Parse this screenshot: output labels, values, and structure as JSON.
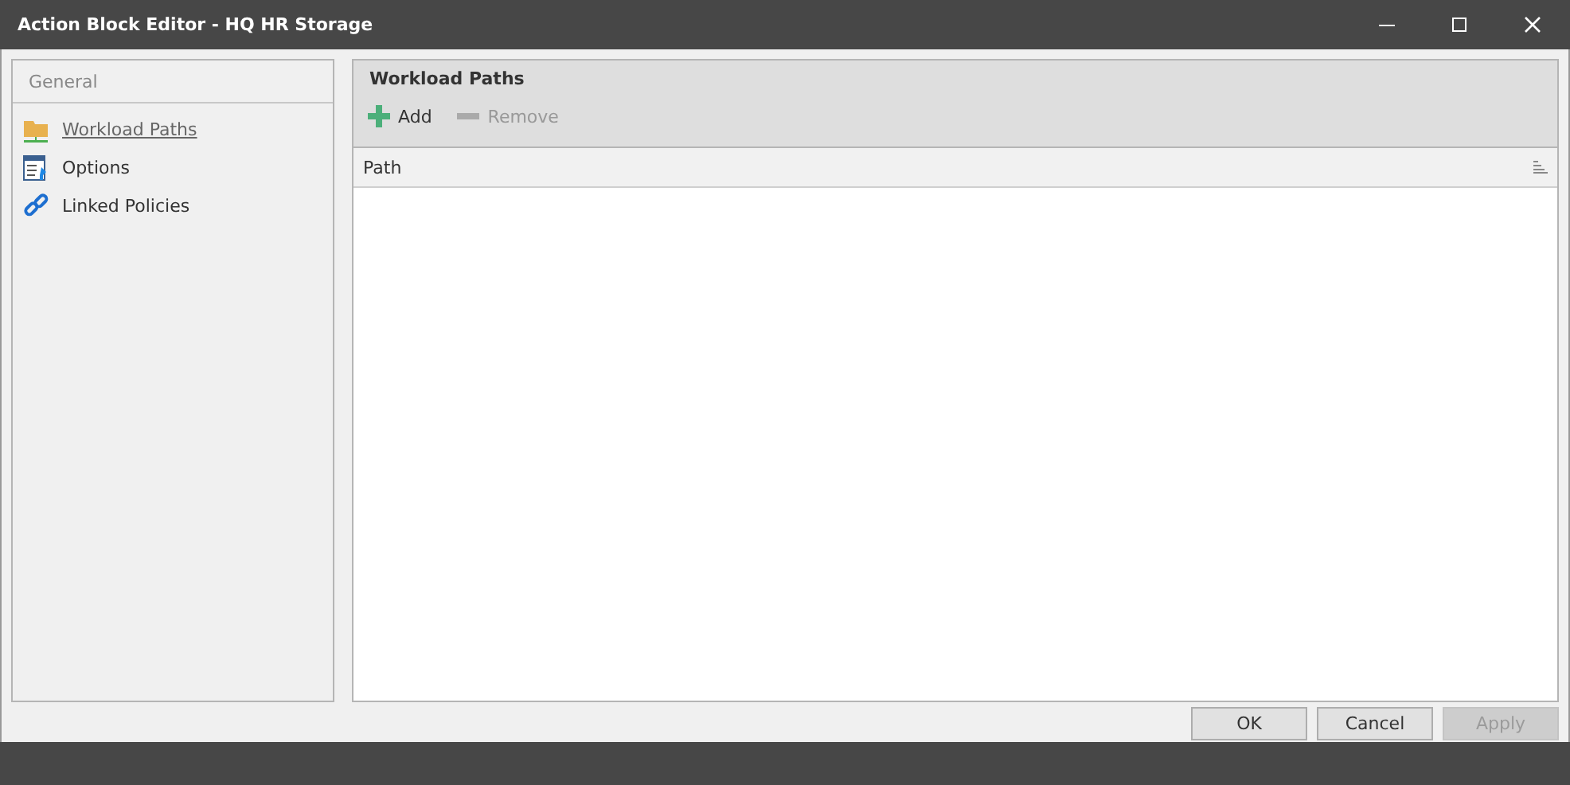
{
  "window": {
    "title": "Action Block Editor - HQ HR Storage"
  },
  "sidebar": {
    "header": "General",
    "items": [
      {
        "label": "Workload Paths",
        "kind": "folder",
        "selected": true
      },
      {
        "label": "Options",
        "kind": "options",
        "selected": false
      },
      {
        "label": "Linked Policies",
        "kind": "link",
        "selected": false
      }
    ]
  },
  "panel": {
    "title": "Workload Paths",
    "toolbar": [
      {
        "label": "Add",
        "kind": "add",
        "disabled": false
      },
      {
        "label": "Remove",
        "kind": "remove",
        "disabled": true
      }
    ],
    "table": {
      "columns": [
        "Path"
      ]
    }
  },
  "buttons": [
    {
      "label": "OK",
      "disabled": false
    },
    {
      "label": "Cancel",
      "disabled": false
    },
    {
      "label": "Apply",
      "disabled": true
    }
  ]
}
